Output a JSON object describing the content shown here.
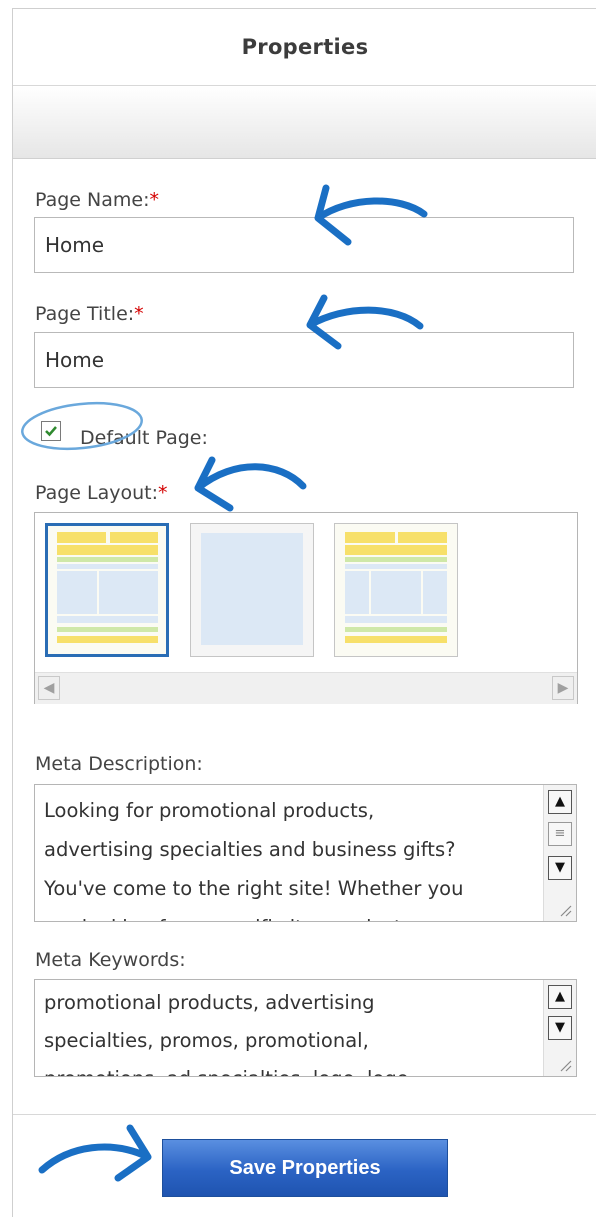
{
  "panel": {
    "title": "Properties"
  },
  "page_name": {
    "label": "Page Name:",
    "required_mark": "*",
    "value": "Home"
  },
  "page_title": {
    "label": "Page Title:",
    "required_mark": "*",
    "value": "Home"
  },
  "default_page": {
    "label": "Default Page:",
    "checked": true
  },
  "page_layout": {
    "label": "Page Layout:",
    "required_mark": "*",
    "options": [
      {
        "name": "header-two-columns",
        "selected": true
      },
      {
        "name": "single-blank",
        "selected": false
      },
      {
        "name": "header-three-columns",
        "selected": false
      }
    ],
    "scroll_left_icon": "chevron-left-icon",
    "scroll_right_icon": "chevron-right-icon"
  },
  "meta_description": {
    "label": "Meta Description:",
    "lines": [
      "Looking for promotional products,",
      "advertising specialties and business gifts?",
      "You've come to the right site! Whether you",
      "are looking for a specific item or just"
    ]
  },
  "meta_keywords": {
    "label": "Meta Keywords:",
    "lines": [
      "promotional products, advertising",
      "specialties, promos, promotional,",
      "promotions, ad specialties, logo, logo"
    ]
  },
  "save_button": {
    "label": "Save Properties"
  },
  "colors": {
    "accent_blue": "#2b63c4",
    "annotation_blue": "#1a6fc4",
    "required_red": "#d40000",
    "layout_yellow": "#f7e06a",
    "layout_green": "#cfe8a8",
    "layout_lightblue": "#dce8f5"
  }
}
